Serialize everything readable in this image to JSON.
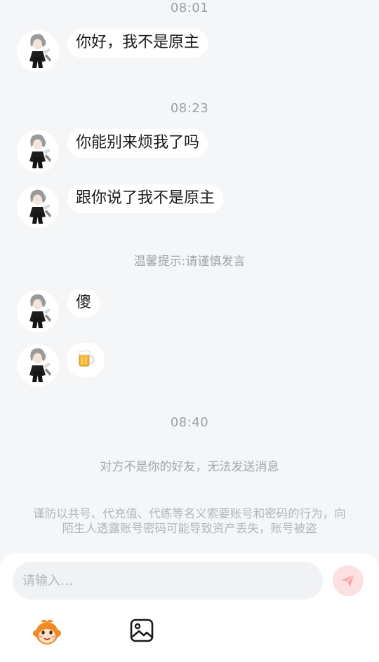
{
  "conversation": {
    "times": [
      "08:01",
      "08:23",
      "08:40"
    ],
    "messages": [
      {
        "text": "你好，我不是原主"
      },
      {
        "text": "你能别来烦我了吗"
      },
      {
        "text": "跟你说了我不是原主"
      },
      {
        "text": "傻"
      },
      {
        "text": "🍺",
        "icon": "beer-mug-emoji"
      }
    ],
    "tip": "温馨提示:请谨慎发言",
    "blocked_notice": "对方不是你的好友，无法发送消息",
    "security_warning": "谨防以共号、代充值、代练等名义索要账号和密码的行为，向陌生人透露账号密码可能导致资产丢失，账号被盗"
  },
  "composer": {
    "placeholder": "请输入…",
    "send_icon": "paper-plane-icon",
    "tools": [
      "monkey-emoji-icon",
      "image-icon"
    ]
  },
  "colors": {
    "background": "#f5f6f8",
    "bubble": "#ffffff",
    "send_button": "#fde0e1",
    "send_icon": "#f7a5a8"
  }
}
